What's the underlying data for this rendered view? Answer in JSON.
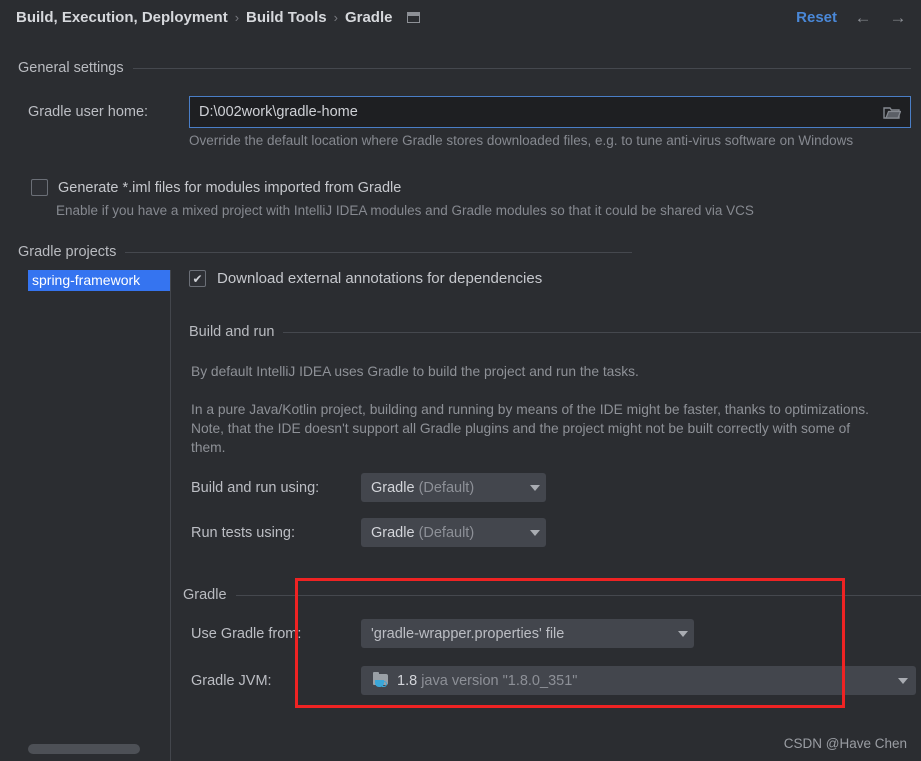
{
  "header": {
    "breadcrumbs": [
      "Build, Execution, Deployment",
      "Build Tools",
      "Gradle"
    ],
    "separator": "›",
    "panel_icon": "panel-toggle-icon",
    "reset_label": "Reset",
    "back_arrow": "←",
    "forward_arrow": "→"
  },
  "general_settings": {
    "section_title": "General settings",
    "gradle_user_home": {
      "label": "Gradle user home:",
      "value": "D:\\002work\\gradle-home",
      "browse_icon": "folder-icon",
      "hint": "Override the default location where Gradle stores downloaded files, e.g. to tune anti-virus software on Windows"
    },
    "generate_iml": {
      "label": "Generate *.iml files for modules imported from Gradle",
      "checked": false,
      "hint": "Enable if you have a mixed project with IntelliJ IDEA modules and Gradle modules so that it could be shared via VCS"
    }
  },
  "gradle_projects": {
    "section_title": "Gradle projects",
    "tree": {
      "items": [
        {
          "label": "spring-framework",
          "selected": true
        }
      ]
    }
  },
  "pane": {
    "download_annotations": {
      "label": "Download external annotations for dependencies",
      "checked": true
    },
    "build_and_run": {
      "section_title": "Build and run",
      "paragraph_1": "By default IntelliJ IDEA uses Gradle to build the project and run the tasks.",
      "paragraph_2": "In a pure Java/Kotlin project, building and running by means of the IDE might be faster, thanks to optimizations. Note, that the IDE doesn't support all Gradle plugins and the project might not be built correctly with some of them.",
      "build_run_using": {
        "label": "Build and run using:",
        "value_strong": "Gradle",
        "value_dim": "(Default)"
      },
      "run_tests_using": {
        "label": "Run tests using:",
        "value_strong": "Gradle",
        "value_dim": "(Default)"
      }
    },
    "gradle": {
      "section_title": "Gradle",
      "use_gradle_from": {
        "label": "Use Gradle from:",
        "value": "'gradle-wrapper.properties' file"
      },
      "gradle_jvm": {
        "label": "Gradle JVM:",
        "icon": "jdk-icon",
        "version": "1.8",
        "description": "java version \"1.8.0_351\""
      }
    }
  },
  "annotation": {
    "highlight_color": "#ef2323"
  },
  "watermark": "CSDN @Have Chen"
}
